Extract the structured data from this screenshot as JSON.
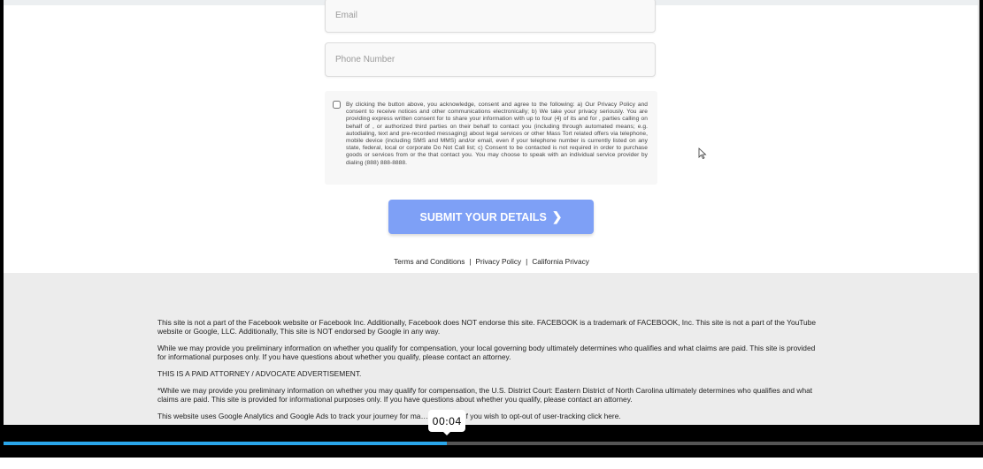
{
  "form": {
    "email_placeholder": "Email",
    "phone_placeholder": "Phone Number",
    "consent_text": "By clicking the button above, you acknowledge, consent and agree to the following: a) Our Privacy Policy and consent to receive notices and other communications electronically; b) We take your privacy seriously. You are providing express written consent for to share your information with up to four (4) of its and for , parties calling on behalf of , or authorized third parties on their behalf to contact you (including through automated means; e.g. autodialing, text and pre-recorded messaging) about legal services or other Mass Tort related offers via telephone, mobile device (including SMS and MMS) and/or email, even if your telephone number is currently listed on any state, federal, local or corporate Do Not Call list; c) Consent to be contacted is not required in order to purchase goods or services from or the that contact you. You may choose to speak with an individual service provider by dialing (888) 888-8888.",
    "submit_label": "SUBMIT YOUR DETAILS",
    "submit_color": "#7ea0f6"
  },
  "links": {
    "terms": "Terms and Conditions",
    "privacy": "Privacy Policy",
    "california": "California Privacy",
    "separator": "|"
  },
  "footer": {
    "disclaimers": [
      "This site is not a part of the Facebook website or Facebook Inc. Additionally, Facebook does NOT endorse this site. FACEBOOK is a trademark of FACEBOOK, Inc. This site is not a part of the YouTube website or Google, LLC. Additionally, This site is NOT endorsed by Google in any way.",
      "While we may provide you preliminary information on whether you qualify for compensation, your local governing body ultimately determines who qualifies and what claims are paid. This site is provided for informational purposes only. If you have questions about whether you qualify, please contact an attorney.",
      "THIS IS A PAID ATTORNEY / ADVOCATE ADVERTISEMENT.",
      "*While we may provide you preliminary information on whether you may qualify for compensation, the U.S. District Court: Eastern District of North Carolina ultimately determines who qualifies and what claims are paid. This site is provided for informational purposes only. If you have questions about whether you qualify, please contact an attorney.",
      "This website uses Google Analytics and Google Ads to track your journey for ma… …rposes. If you wish to opt-out of user-tracking click here."
    ]
  },
  "player": {
    "current_time": "00:04",
    "progress_percent": 45.3,
    "progress_color": "#2aa6ea"
  },
  "icons": {
    "submit": "chevron-right-icon",
    "cursor": "mouse-pointer-icon"
  }
}
